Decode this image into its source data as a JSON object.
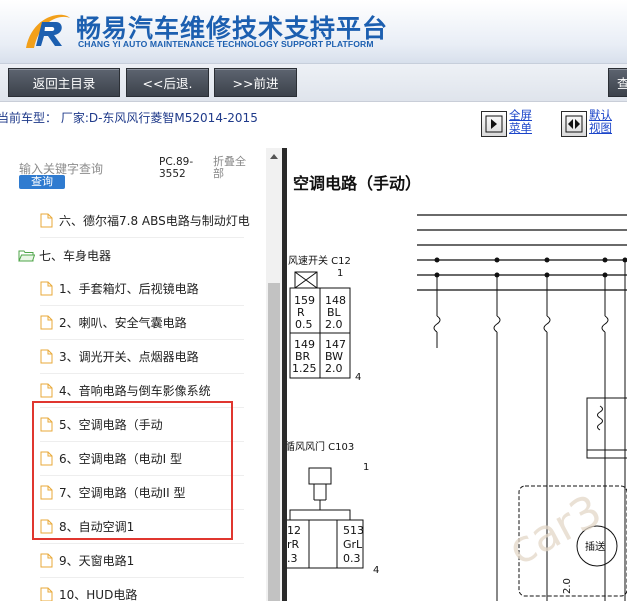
{
  "header": {
    "title": "畅易汽车维修技术支持平台",
    "subtitle": "CHANG YI AUTO MAINTENANCE TECHNOLOGY SUPPORT PLATFORM"
  },
  "toolbar": {
    "home_label": "返回主目录",
    "back_label": "<<后退.",
    "forward_label": ">>前进",
    "edge_label": "查"
  },
  "info": {
    "current_car": "当前车型： 厂家:D-东风风行菱智M52014-2015",
    "fullscreen_label": "全屏菜单",
    "default_view_label": "默认视图"
  },
  "sidebar": {
    "search_hint": "输入关键字查询",
    "search_button": "查询",
    "pc_code": "PC.89-3552",
    "collapse_label": "折叠全部",
    "items": [
      {
        "label": "六、德尔福7.8 ABS电路与制动灯电"
      },
      {
        "label": "七、车身电器"
      },
      {
        "label": "1、手套箱灯、后视镜电路"
      },
      {
        "label": "2、喇叭、安全气囊电路"
      },
      {
        "label": "3、调光开关、点烟器电路"
      },
      {
        "label": "4、音响电路与倒车影像系统"
      },
      {
        "label": "5、空调电路（手动"
      },
      {
        "label": "6、空调电路（电动I 型"
      },
      {
        "label": "7、空调电路（电动II 型"
      },
      {
        "label": "8、自动空调1"
      },
      {
        "label": "9、天窗电路1"
      },
      {
        "label": "10、HUD电路"
      }
    ]
  },
  "diagram": {
    "title": "空调电路（手动）",
    "connector1_label": "风速开关 C12",
    "connector1_pin": "1",
    "connector1_pin4": "4",
    "c1_cells": [
      [
        "159",
        "R",
        "0.5"
      ],
      [
        "148",
        "BL",
        "2.0"
      ],
      [
        "149",
        "BR",
        "1.25"
      ],
      [
        "147",
        "BW",
        "2.0"
      ]
    ],
    "connector2_label": "循风风门 C103",
    "connector2_pin": "1",
    "connector2_pin4": "4",
    "c2_cells": [
      [
        "12",
        "rR",
        ".3"
      ],
      [
        "513",
        "GrL",
        "0.3"
      ]
    ],
    "side_label": "2.0",
    "device_label": "插送",
    "watermark": "car3"
  },
  "colors": {
    "brand_blue": "#1c5fb0",
    "link_blue": "#1a44c9",
    "highlight_red": "#e0362f",
    "search_button": "#2f7bd0"
  }
}
